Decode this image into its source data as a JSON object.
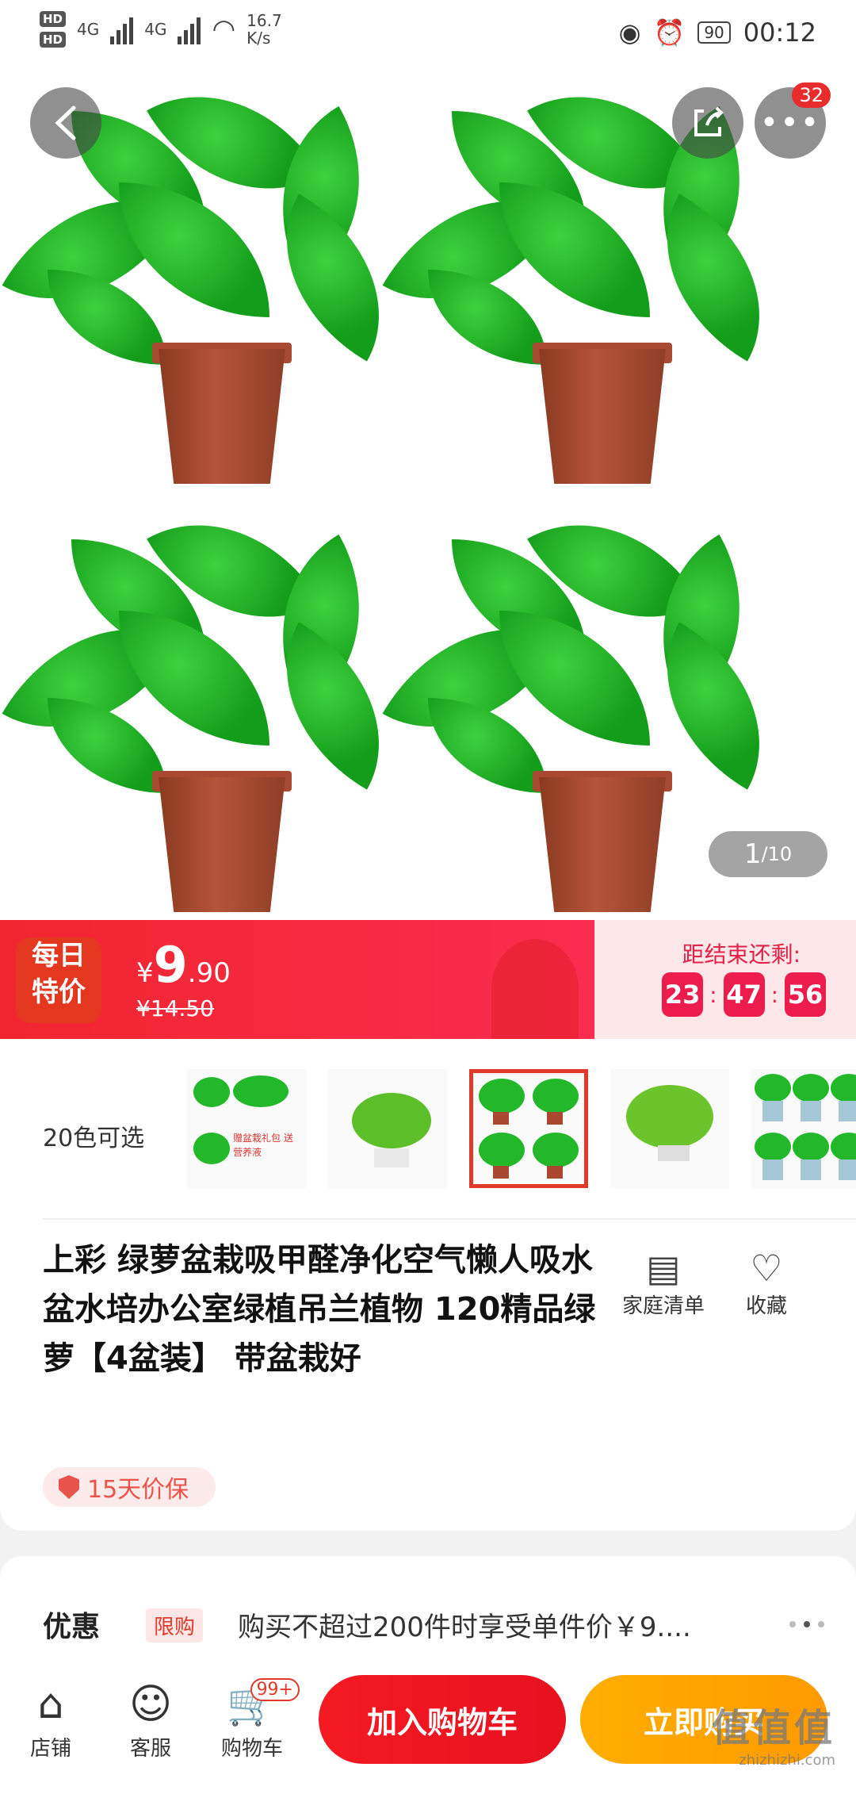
{
  "status_bar": {
    "sim1": "HD",
    "sim2": "HD",
    "net1": "4G",
    "net2": "4G",
    "speed": "16.7",
    "speed_unit": "K/s",
    "battery": "90",
    "time": "00:12"
  },
  "header": {
    "more_badge": "32",
    "pager_current": "1",
    "pager_total": "/10"
  },
  "promo": {
    "tag_line1": "每日",
    "tag_line2": "特价",
    "currency": "¥",
    "price_int": "9",
    "price_dec": ".90",
    "original_price": "¥14.50",
    "countdown_label": "距结束还剩:",
    "hours": "23",
    "minutes": "47",
    "seconds": "56",
    "separator": ":"
  },
  "variants": {
    "label": "20色可选",
    "thumb_note": "赠盆栽礼包 送营养液"
  },
  "product": {
    "title": "上彩 绿萝盆栽吸甲醛净化空气懒人吸水盆水培办公室绿植吊兰植物 120精品绿萝【4盆装】 带盆栽好",
    "action_list": "家庭清单",
    "action_fav": "收藏",
    "guarantee": "15天价保"
  },
  "discount": {
    "label": "优惠",
    "tag": "限购",
    "text": "购买不超过200件时享受单件价￥9...."
  },
  "bottom_bar": {
    "shop": "店铺",
    "service": "客服",
    "cart": "购物车",
    "cart_badge": "99+",
    "add_cart": "加入购物车",
    "buy_now": "立即购买"
  },
  "watermark": {
    "big": "值值值",
    "small": "zhizhizhi.com"
  },
  "colors": {
    "promo_red": "#f0252e",
    "countdown_pink": "#ec1c4c",
    "add_cart_red": "#f51a22",
    "buy_orange": "#ffa500"
  }
}
